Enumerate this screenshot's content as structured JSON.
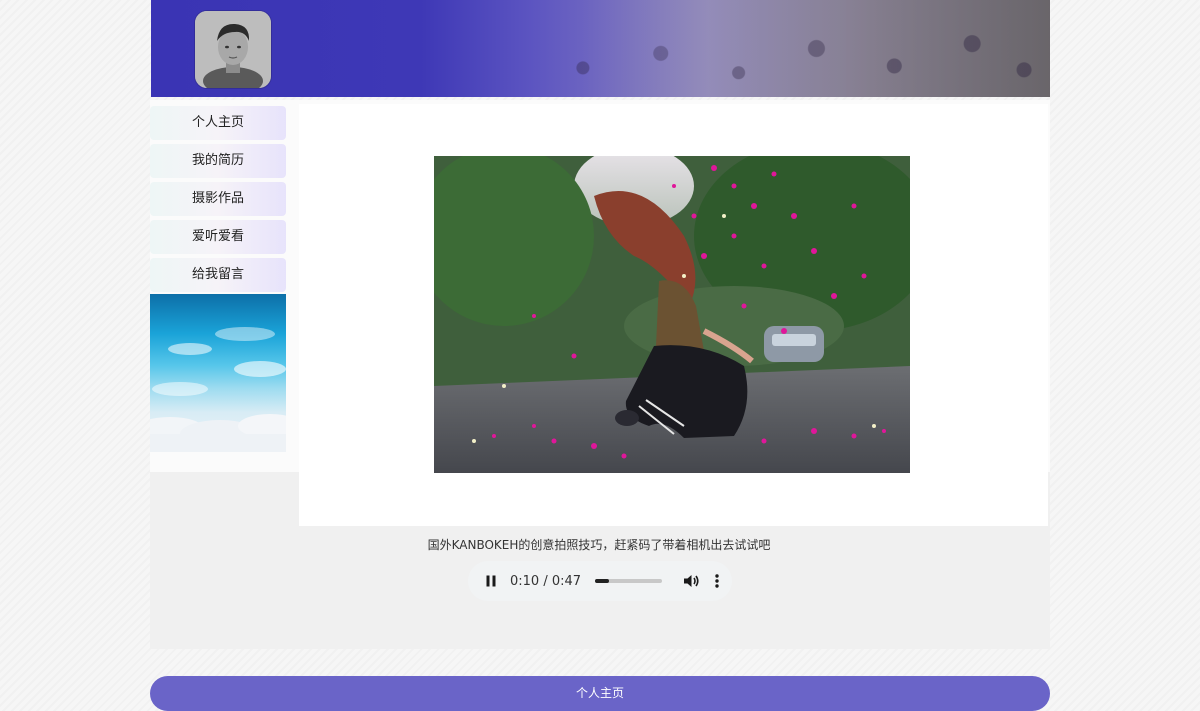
{
  "nav": {
    "items": [
      {
        "label": "个人主页"
      },
      {
        "label": "我的简历"
      },
      {
        "label": "摄影作品"
      },
      {
        "label": "爱听爱看"
      },
      {
        "label": "给我留言"
      }
    ]
  },
  "main": {
    "caption": "国外KANBOKEH的创意拍照技巧，赶紧码了带着相机出去试试吧"
  },
  "audio": {
    "time": "0:10 / 0:47",
    "progress": 0.2128,
    "state": "playing"
  },
  "footer": {
    "label": "个人主页"
  },
  "colors": {
    "banner": "#3a34b4",
    "footer": "#6a64c8"
  }
}
